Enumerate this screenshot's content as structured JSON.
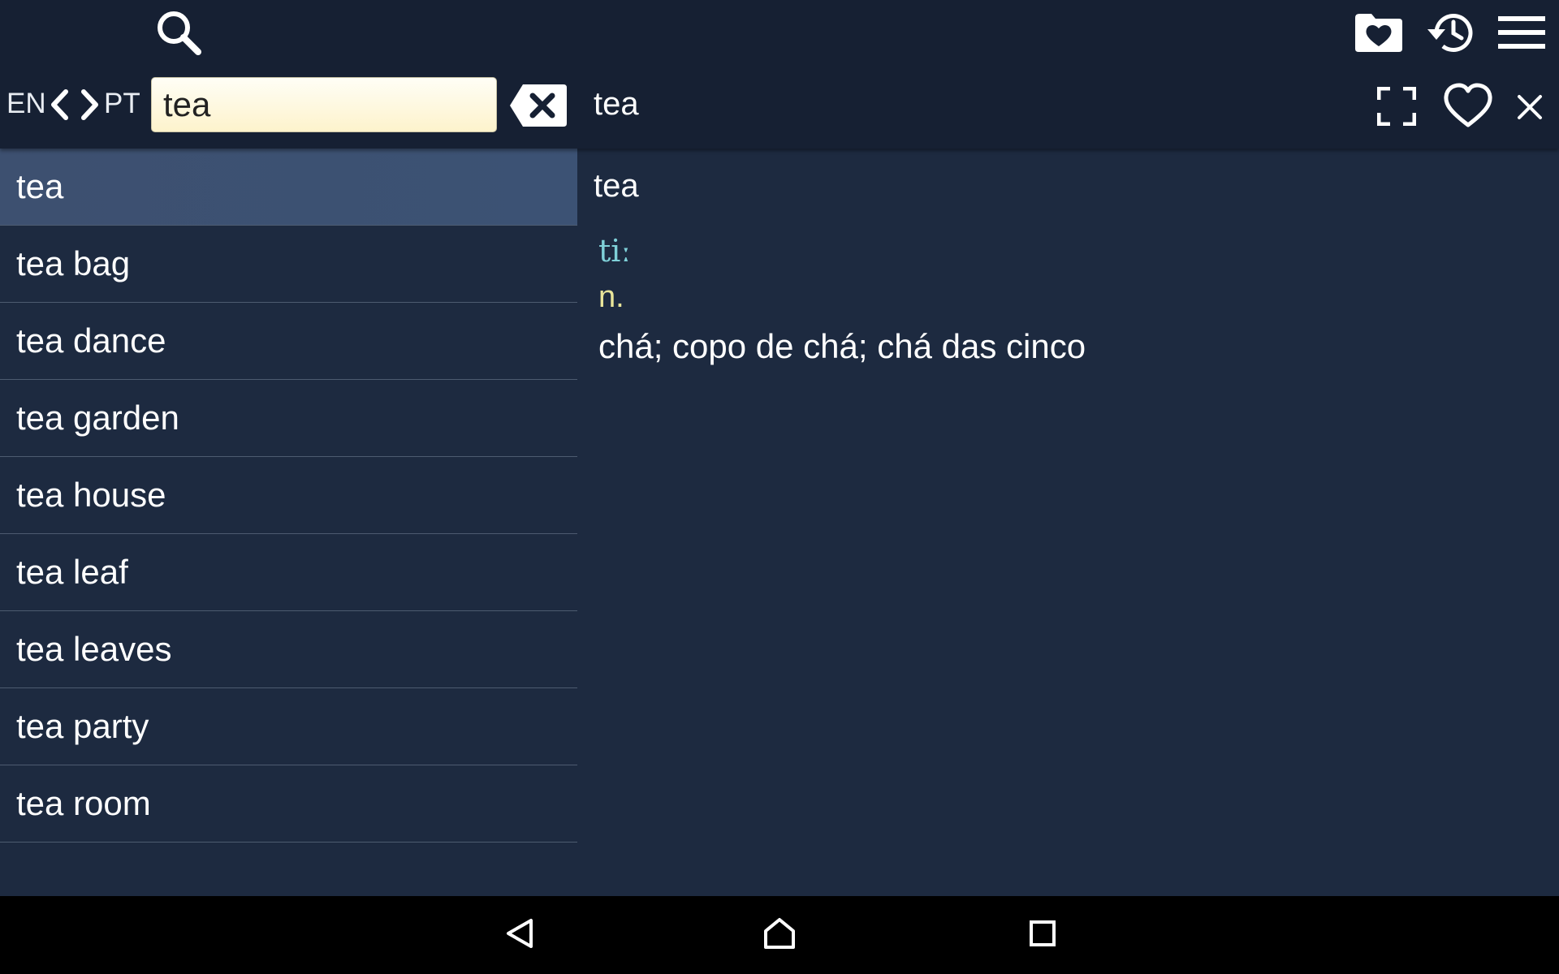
{
  "toolbar": {
    "icons": {
      "search": "search-icon",
      "favorites_folder": "heart-folder-icon",
      "history": "history-icon",
      "menu": "hamburger-menu-icon"
    }
  },
  "language": {
    "from": "EN",
    "to": "PT",
    "swap_left_icon": "chevron-left-icon",
    "swap_right_icon": "chevron-right-icon"
  },
  "search": {
    "value": "tea",
    "placeholder": "",
    "clear_icon": "backspace-x-icon"
  },
  "entry_header": {
    "word": "tea",
    "icons": {
      "fullscreen": "fullscreen-icon",
      "favorite": "heart-outline-icon",
      "close": "close-icon"
    }
  },
  "word_list": {
    "selected_index": 0,
    "items": [
      "tea",
      "tea bag",
      "tea dance",
      "tea garden",
      "tea house",
      "tea leaf",
      "tea leaves",
      "tea party",
      "tea room"
    ]
  },
  "entry": {
    "word": "tea",
    "phonetic": "tiː",
    "part_of_speech": "n.",
    "translation": "chá; copo de chá; chá das cinco"
  },
  "colors": {
    "topbar_bg": "#162033",
    "content_bg": "#1d2a40",
    "selected_row_bg": "#3d5070",
    "phonetic_color": "#7fd0d8",
    "pos_color": "#e9e59a",
    "search_field_bg": "#fdf3cc"
  },
  "navbar": {
    "icons": [
      "back-icon",
      "home-icon",
      "recent-apps-icon"
    ]
  }
}
